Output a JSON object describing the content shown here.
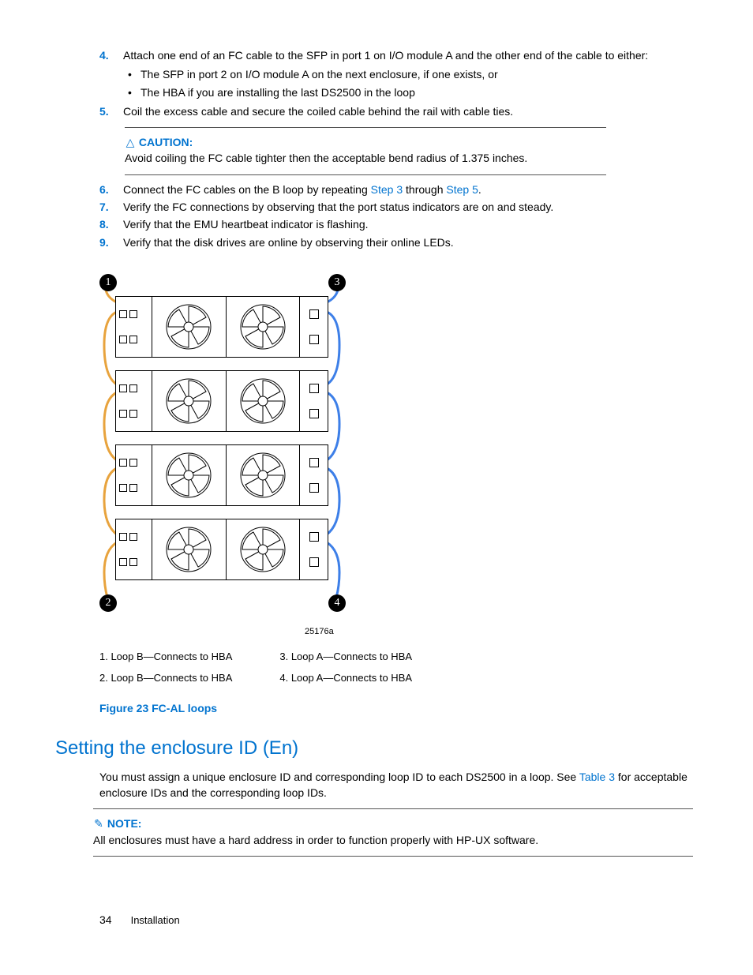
{
  "steps": {
    "s4": {
      "num": "4.",
      "text": "Attach one end of an FC cable to the SFP in port 1 on I/O module A and the other end of the cable to either:",
      "sub1": "The SFP in port 2 on I/O module A on the next enclosure, if one exists, or",
      "sub2": "The HBA if you are installing the last DS2500 in the loop"
    },
    "s5": {
      "num": "5.",
      "text": "Coil the excess cable and secure the coiled cable behind the rail with cable ties."
    },
    "caution": {
      "title": "CAUTION:",
      "text": "Avoid coiling the FC cable tighter then the acceptable bend radius of 1.375 inches."
    },
    "s6": {
      "num": "6.",
      "pre": "Connect the FC cables on the B loop by repeating ",
      "link1": "Step 3",
      "mid": " through ",
      "link2": "Step 5",
      "post": "."
    },
    "s7": {
      "num": "7.",
      "text": "Verify the FC connections by observing that the port status indicators are on and steady."
    },
    "s8": {
      "num": "8.",
      "text": "Verify that the EMU heartbeat indicator is flashing."
    },
    "s9": {
      "num": "9.",
      "text": "Verify that the disk drives are online by observing their online LEDs."
    }
  },
  "figure": {
    "callouts": {
      "c1": "1",
      "c2": "2",
      "c3": "3",
      "c4": "4"
    },
    "code": "25176a",
    "legend": {
      "l1": "1.  Loop B—Connects to HBA",
      "l2": "2.  Loop B—Connects to HBA",
      "l3": "3.  Loop A—Connects to HBA",
      "l4": "4.  Loop A—Connects to HBA"
    },
    "caption": "Figure 23 FC-AL loops"
  },
  "section": {
    "title": "Setting the enclosure ID (En)",
    "para_pre": "You must assign a unique enclosure ID and corresponding loop ID to each DS2500 in a loop.  See ",
    "para_link": "Table 3",
    "para_post": " for acceptable enclosure IDs and the corresponding loop IDs."
  },
  "note": {
    "title": "NOTE:",
    "text": "All enclosures must have a hard address in order to function properly with HP-UX software."
  },
  "footer": {
    "page": "34",
    "section": "Installation"
  }
}
